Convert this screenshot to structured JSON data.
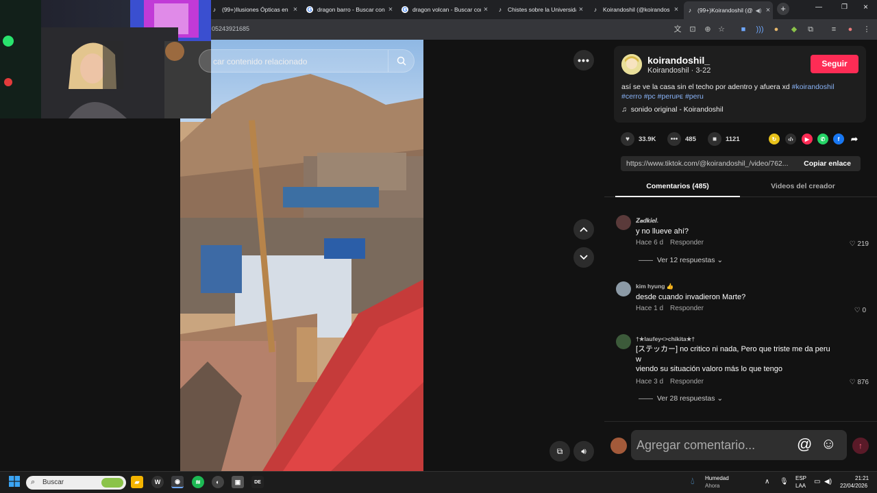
{
  "browser": {
    "tabs": [
      {
        "title": "(99+)Ilusiones Ópticas en",
        "icon": "tiktok"
      },
      {
        "title": "dragon barro - Buscar con",
        "icon": "google"
      },
      {
        "title": "dragon volcan - Buscar con",
        "icon": "google"
      },
      {
        "title": "Chistes sobre la Universida",
        "icon": "tiktok"
      },
      {
        "title": "Koirandoshil (@koirandos",
        "icon": "tiktok"
      },
      {
        "title": "(99+)Koirandoshil (@",
        "icon": "tiktok",
        "active": true
      }
    ],
    "url_tail": "05243921685"
  },
  "video": {
    "search_placeholder": "car contenido relacionado"
  },
  "author": {
    "username": "koirandoshil_",
    "subline": "Koirandoshil · 3-22",
    "follow_label": "Seguir"
  },
  "caption": {
    "text": "así se ve la casa sin el techo por adentro y afuera xd ",
    "tags": [
      "#koirandoshil",
      "#cerro",
      "#pc",
      "#peruᴘᴇ",
      "#peru"
    ]
  },
  "music": "sonido original - Koirandoshil",
  "stats": {
    "likes": "33.9K",
    "comments": "485",
    "saves": "1121"
  },
  "share": {
    "link": "https://www.tiktok.com/@koirandoshil_/video/762...",
    "copy_label": "Copiar enlace"
  },
  "comment_tabs": {
    "comments": "Comentarios (485)",
    "creator_videos": "Videos del creador"
  },
  "comments": [
    {
      "name": "𝒁𝒂𝒅𝒌𝒊𝒆𝒍.",
      "text": "y no llueve ahí?",
      "time": "Hace 6 d",
      "reply": "Responder",
      "likes": "219",
      "replies": "Ver 12 respuestas"
    },
    {
      "name": "kim hyung 👍",
      "text": "desde cuando invadieron Marte?",
      "time": "Hace 1 d",
      "reply": "Responder",
      "likes": "0"
    },
    {
      "name": "†★laufey<>chikita★†",
      "text": "[ステッカー] no critico ni nada, Pero que triste me da peru",
      "text2": "w",
      "text3": "viendo su situación valoro más lo que tengo",
      "time": "Hace 3 d",
      "reply": "Responder",
      "likes": "876",
      "replies": "Ver 28 respuestas"
    }
  ],
  "comment_input": {
    "placeholder": "Agregar comentario..."
  },
  "taskbar": {
    "search_placeholder": "Buscar",
    "weather_title": "Humedad",
    "weather_sub": "Ahora",
    "lang1": "ESP",
    "lang2": "LAA",
    "time": "21:21",
    "date": "22/04/2026"
  },
  "colors": {
    "accent": "#fe2c55",
    "hashtag": "#8ab4f8"
  }
}
